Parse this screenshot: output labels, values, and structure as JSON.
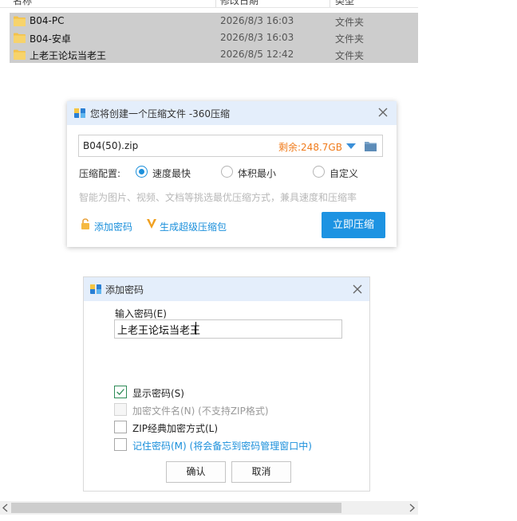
{
  "explorer": {
    "columns": {
      "name": "名称",
      "date": "修改日期",
      "type": "类型"
    },
    "files": [
      {
        "name": "B04-PC",
        "date": "2026/8/3 16:03",
        "type": "文件夹"
      },
      {
        "name": "B04-安卓",
        "date": "2026/8/3 16:03",
        "type": "文件夹"
      },
      {
        "name": "上老王论坛当老王",
        "date": "2026/8/5 12:42",
        "type": "文件夹"
      }
    ]
  },
  "compress_dialog": {
    "title": "您将创建一个压缩文件 -360压缩",
    "filename": "B04(50).zip",
    "free_space": "剩余:248.7GB",
    "config_label": "压缩配置:",
    "options": [
      {
        "label": "速度最快",
        "checked": true
      },
      {
        "label": "体积最小",
        "checked": false
      },
      {
        "label": "自定义",
        "checked": false
      }
    ],
    "hint": "智能为图片、视频、文档等挑选最优压缩方式，兼具速度和压缩率",
    "add_password_link": "添加密码",
    "super_package_link": "生成超级压缩包",
    "compress_button": "立即压缩",
    "colors": {
      "accent": "#1d93e2",
      "orange": "#f07b1b",
      "titlebar": "#e4eefb"
    },
    "icons": [
      "archive-icon",
      "close-icon",
      "dropdown-arrow-icon",
      "folder-browse-icon",
      "lock-icon",
      "v-badge-icon"
    ]
  },
  "password_dialog": {
    "title": "添加密码",
    "input_label": "输入密码(E)",
    "password_value": "上老王论坛当老王",
    "options": [
      {
        "label": "显示密码(S)",
        "checked": true,
        "disabled": false,
        "note": ""
      },
      {
        "label": "加密文件名(N) (不支持ZIP格式)",
        "checked": false,
        "disabled": true,
        "note": ""
      },
      {
        "label": "ZIP经典加密方式(L)",
        "checked": false,
        "disabled": false,
        "note": ""
      },
      {
        "label": "记住密码(M)",
        "checked": false,
        "disabled": false,
        "note": " (将会备忘到密码管理窗口中)"
      }
    ],
    "ok_button": "确认",
    "cancel_button": "取消"
  }
}
